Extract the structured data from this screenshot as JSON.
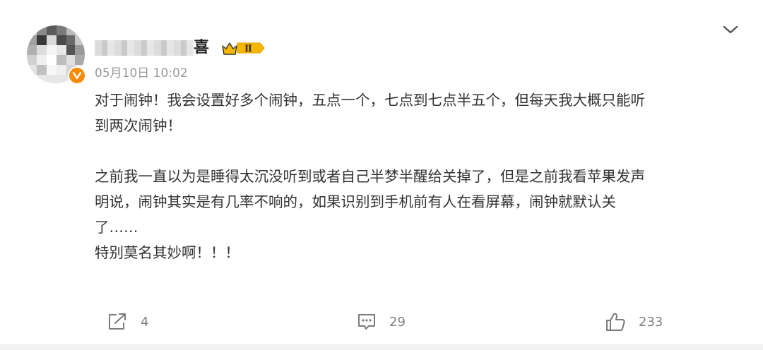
{
  "post": {
    "username_visible_tail": "喜",
    "level_badge": "Ⅱ",
    "timestamp": "05月10日 10:02",
    "content": [
      "对于闹钟！我会设置好多个闹钟，五点一个，七点到七点半五个，但每天我大概只能听",
      "到两次闹钟！",
      "",
      "之前我一直以为是睡得太沉没听到或者自己半梦半醒给关掉了，但是之前我看苹果发声",
      "明说，闹钟其实是有几率不响的，如果识别到手机前有人在看屏幕，闹钟就默认关",
      "了……",
      "特别莫名其妙啊！！！"
    ]
  },
  "actions": {
    "share_count": "4",
    "comment_count": "29",
    "like_count": "233"
  },
  "icons": {
    "avatar_badge": "verified-v-icon",
    "level": "crown-level-icon",
    "menu": "chevron-down-icon",
    "share": "share-icon",
    "comment": "comment-icon",
    "like": "thumbs-up-icon"
  },
  "colors": {
    "text": "#333333",
    "meta": "#999999",
    "action": "#808080",
    "badge_orange": "#f78a00",
    "level_gold": "#f5b800"
  }
}
